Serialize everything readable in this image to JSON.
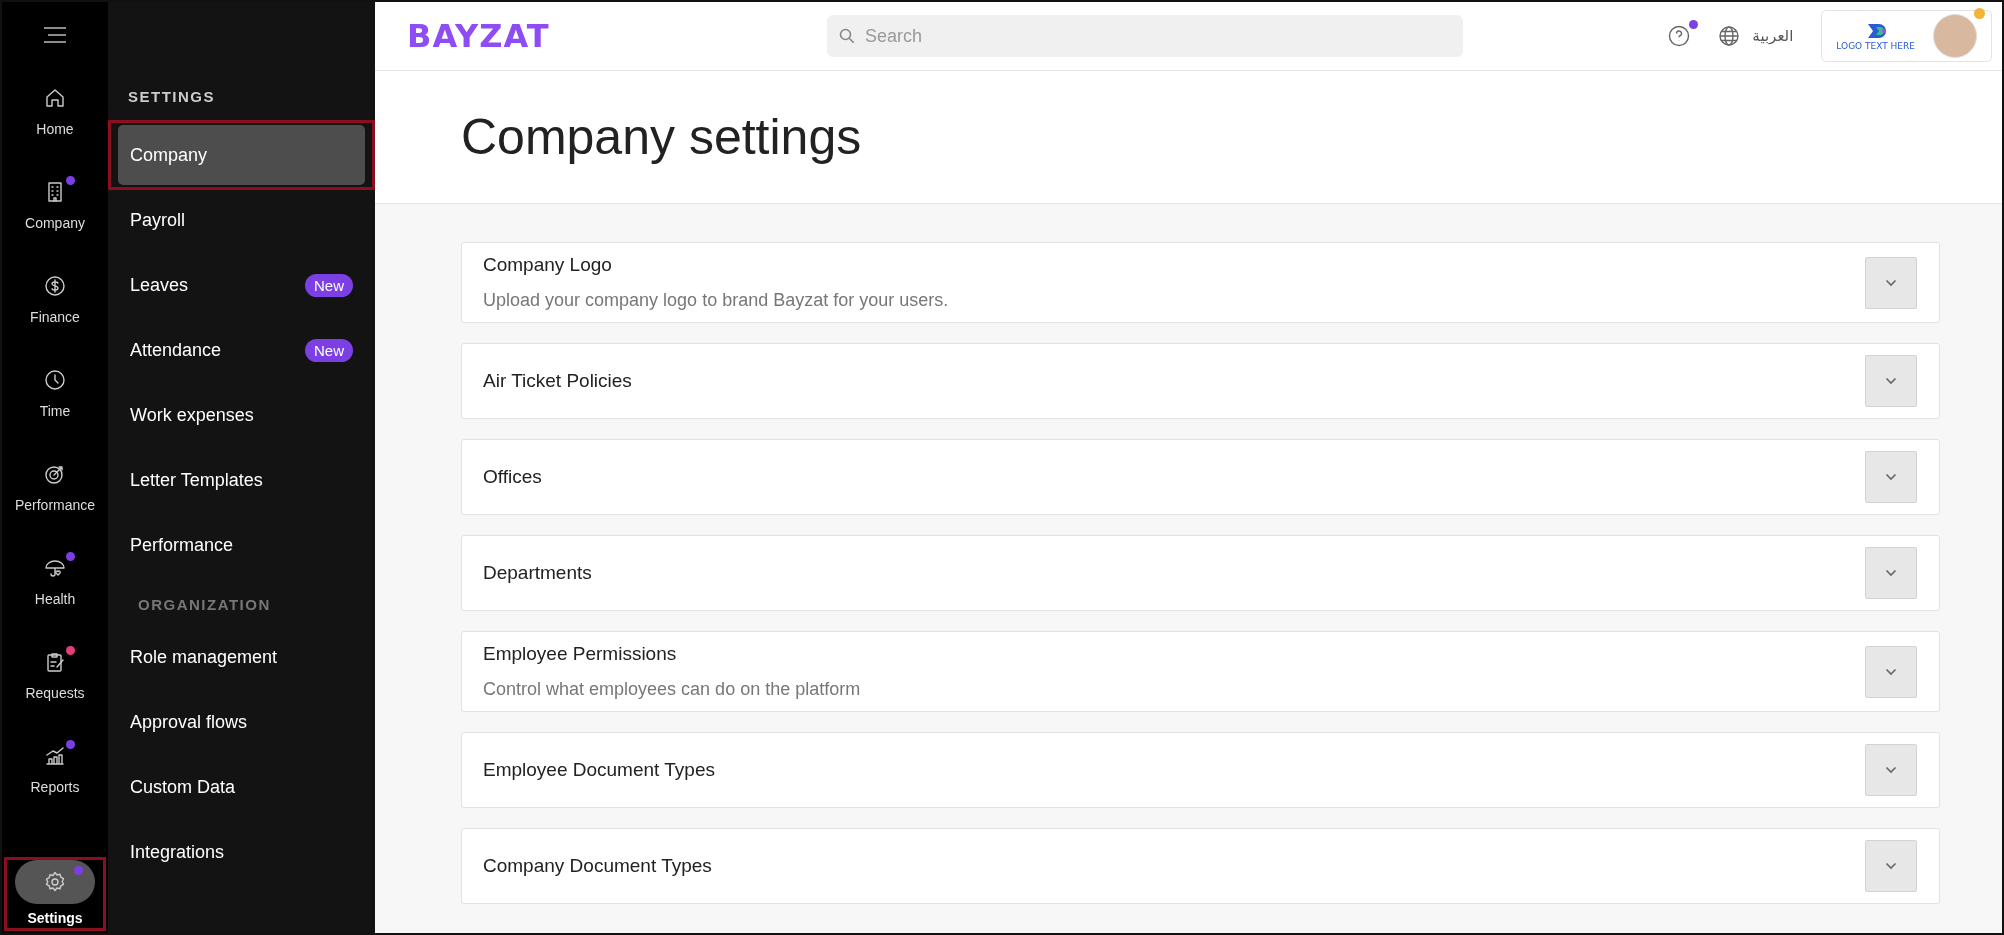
{
  "nav": [
    {
      "label": "Home",
      "selected": false
    },
    {
      "label": "Company",
      "selected": false,
      "color": "#7b3fe4"
    },
    {
      "label": "Finance",
      "selected": false
    },
    {
      "label": "Time",
      "selected": false
    },
    {
      "label": "Performance",
      "selected": false
    },
    {
      "label": "Health",
      "selected": false,
      "color": "#7b3fe4"
    },
    {
      "label": "Requests",
      "selected": false,
      "color": "#e0407a"
    },
    {
      "label": "Reports",
      "selected": false,
      "color": "#7b3fe4"
    },
    {
      "label": "Settings",
      "selected": true,
      "color": "#7b3fe4"
    }
  ],
  "settings_menu": {
    "sections": [
      {
        "heading": "SETTINGS",
        "items": [
          {
            "label": "Company",
            "selected": true
          },
          {
            "label": "Payroll",
            "selected": false
          },
          {
            "label": "Leaves",
            "selected": false,
            "badge": "New"
          },
          {
            "label": "Attendance",
            "selected": false,
            "badge": "New"
          },
          {
            "label": "Work expenses",
            "selected": false
          },
          {
            "label": "Letter Templates",
            "selected": false
          },
          {
            "label": "Performance",
            "selected": false
          }
        ]
      },
      {
        "heading": "ORGANIZATION",
        "items": [
          {
            "label": "Role management",
            "selected": false
          },
          {
            "label": "Approval flows",
            "selected": false
          },
          {
            "label": "Custom Data",
            "selected": false
          },
          {
            "label": "Integrations",
            "selected": false
          }
        ]
      }
    ]
  },
  "header": {
    "logo": "BAYZAT",
    "search": {
      "placeholder": "Search"
    },
    "help_unread": true,
    "language": "العربية",
    "company_logo_text": "LOGO TEXT HERE",
    "avatar_online": true
  },
  "page_title": "Company settings",
  "sections": [
    {
      "title": "Company Logo",
      "description": "Upload your company logo to brand Bayzat for your users."
    },
    {
      "title": "Air Ticket Policies"
    },
    {
      "title": "Offices"
    },
    {
      "title": "Departments"
    },
    {
      "title": "Employee Permissions",
      "description": "Control what employees can do on the platform"
    },
    {
      "title": "Employee Document Types"
    },
    {
      "title": "Company Document Types"
    }
  ]
}
